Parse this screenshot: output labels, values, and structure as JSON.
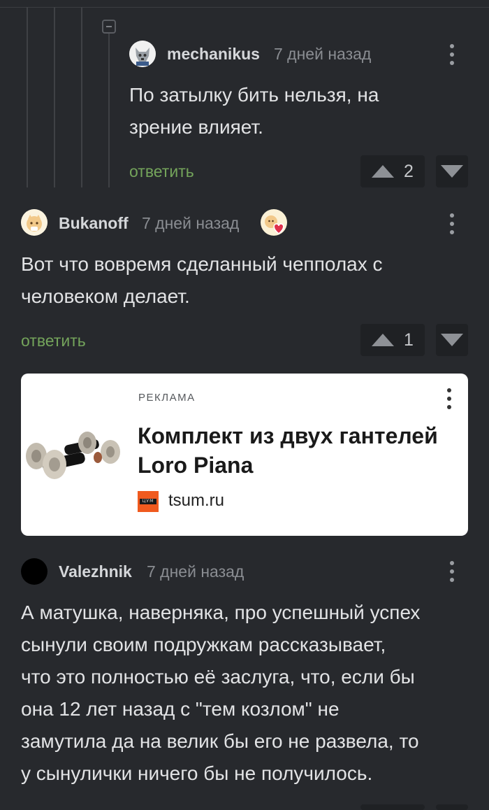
{
  "comments": [
    {
      "username": "mechanikus",
      "time": "7 дней назад",
      "text_lines": [
        "По затылку бить нельзя, на",
        "зрение влияет."
      ],
      "reply_label": "ответить",
      "votes": "2",
      "avatar_icon": "wolf-avatar"
    },
    {
      "username": "Bukanoff",
      "time": "7 дней назад",
      "text_lines": [
        "Вот что вовремя сделанный чепполах с",
        "человеком делает."
      ],
      "reply_label": "ответить",
      "votes": "1",
      "avatar_icon": "cat-avatar",
      "award_icon": "heart-award-icon"
    },
    {
      "username": "Valezhnik",
      "time": "7 дней назад",
      "text_lines": [
        "А матушка, наверняка, про успешный успех",
        "сынули своим подружкам рассказывает,",
        "что это полностью её заслуга, что, если бы",
        "она 12 лет назад с \"тем козлом\" не",
        "замутила да на велик бы его не развела, то",
        "у сынулички ничего бы не получилось."
      ],
      "avatar_icon": "black-circle-avatar"
    }
  ],
  "ad": {
    "label": "РЕКЛАМА",
    "title_lines": [
      "Комплект из двух гантелей",
      "Loro Piana"
    ],
    "domain": "tsum.ru",
    "logo_text": "ЦУМ",
    "image": "dumbbells-image"
  },
  "colors": {
    "background": "#27292d",
    "reply": "#74a45b",
    "vote_box": "#1f2124"
  }
}
